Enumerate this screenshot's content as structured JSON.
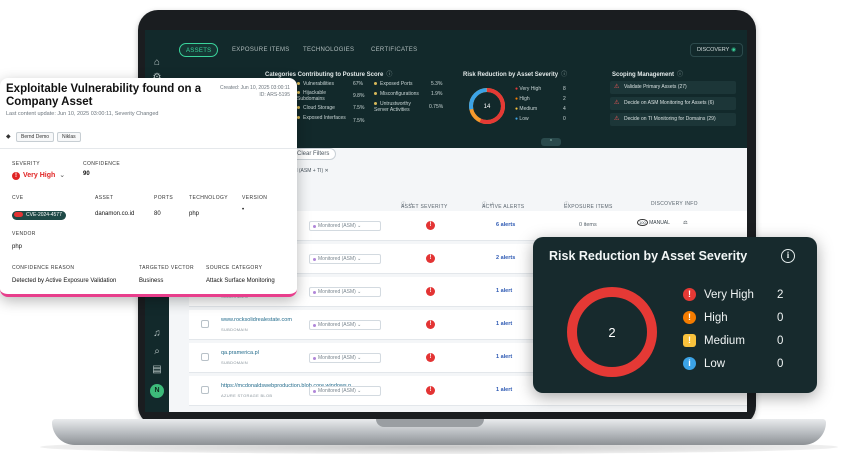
{
  "app": {
    "tabs": [
      {
        "label": "ASSETS",
        "active": true
      },
      {
        "label": "EXPOSURE ITEMS",
        "active": false
      },
      {
        "label": "TECHNOLOGIES",
        "active": false
      },
      {
        "label": "CERTIFICATES",
        "active": false
      }
    ],
    "discovery_label": "DISCOVERY",
    "categories": {
      "title": "Categories Contributing to Posture Score",
      "items": [
        {
          "label": "Vulnerabilities",
          "value": "67%"
        },
        {
          "label": "Hijackable Subdomains",
          "value": "9.8%"
        },
        {
          "label": "Cloud Storage",
          "value": "7.5%"
        },
        {
          "label": "Exposed Interfaces",
          "value": "7.5%"
        },
        {
          "label": "Exposed Ports",
          "value": "5.3%"
        },
        {
          "label": "Misconfigurations",
          "value": "1.9%"
        },
        {
          "label": "Untrustworthy Server Activities",
          "value": "0.75%"
        }
      ]
    },
    "mini_risk": {
      "title": "Risk Reduction by Asset Severity",
      "total": "14",
      "items": [
        {
          "label": "Very High",
          "value": "8"
        },
        {
          "label": "High",
          "value": "2"
        },
        {
          "label": "Medium",
          "value": "4"
        },
        {
          "label": "Low",
          "value": "0"
        }
      ]
    },
    "scoping": {
      "title": "Scoping Management",
      "items": [
        "Validate Primary Assets (27)",
        "Decide on ASM Monitoring for Assets (6)",
        "Decide on TI Monitoring for Domains (29)"
      ]
    },
    "clear_filters": "Clear Filters",
    "filter_chip": "itored (ASM + TI)",
    "table_headers": {
      "asset_severity": "ASSET SEVERITY",
      "active_alerts": "ACTIVE ALERTS",
      "exposure_items": "EXPOSURE ITEMS",
      "discovery_info": "DISCOVERY INFO"
    },
    "rows": [
      {
        "domain": "",
        "type": "",
        "monitor": "Monitored (ASM)",
        "alerts": "6 alerts",
        "exposure": "0 items",
        "discovery": "MANUAL"
      },
      {
        "domain": "",
        "type": "",
        "monitor": "Monitored (ASM)",
        "alerts": "2 alerts",
        "exposure": "",
        "discovery": ""
      },
      {
        "domain": "",
        "type": "SUBDOMAIN",
        "monitor": "Monitored (ASM)",
        "alerts": "1 alert",
        "exposure": "",
        "discovery": ""
      },
      {
        "domain": "www.rocksolidrealestate.com",
        "type": "SUBDOMAIN",
        "monitor": "Monitored (ASM)",
        "alerts": "1 alert",
        "exposure": "",
        "discovery": ""
      },
      {
        "domain": "qa.pramerica.pl",
        "type": "SUBDOMAIN",
        "monitor": "Monitored (ASM)",
        "alerts": "1 alert",
        "exposure": "",
        "discovery": ""
      },
      {
        "domain": "https://mcdonaldswebproduction.blob.core.windows.n...",
        "type": "AZURE STORAGE BLOB",
        "monitor": "Monitored (ASM)",
        "alerts": "1 alert",
        "exposure": "",
        "discovery": ""
      }
    ]
  },
  "vuln_card": {
    "title": "Exploitable Vulnerability found on a Company Asset",
    "created": "Created: Jun 10, 2025 03:00:11",
    "id": "ID: ARS-5195",
    "last_update": "Last content update: Jun 10, 2025 03:00:11, Severity Changed",
    "tags": [
      "Bernd Demo",
      "Niklas"
    ],
    "severity_label": "SEVERITY",
    "severity_value": "Very High",
    "confidence_label": "CONFIDENCE",
    "confidence_value": "90",
    "cve_label": "CVE",
    "cve_value": "CVE-2024-4577",
    "asset_label": "ASSET",
    "asset_value": "danamon.co.id",
    "ports_label": "PORTS",
    "ports_value": "80",
    "technology_label": "TECHNOLOGY",
    "technology_value": "php",
    "version_label": "VERSION",
    "version_value": "•",
    "vendor_label": "VENDOR",
    "vendor_value": "php",
    "confidence_reason_label": "CONFIDENCE REASON",
    "confidence_reason_value": "Detected by Active Exposure Validation",
    "targeted_vector_label": "TARGETED VECTOR",
    "targeted_vector_value": "Business",
    "source_category_label": "SOURCE CATEGORY",
    "source_category_value": "Attack Surface Monitoring"
  },
  "risk_card": {
    "title": "Risk Reduction by Asset Severity",
    "total": "2",
    "items": [
      {
        "label": "Very High",
        "value": "2",
        "color": "#e53935",
        "icon": "!"
      },
      {
        "label": "High",
        "value": "0",
        "color": "#f57c00",
        "icon": "!"
      },
      {
        "label": "Medium",
        "value": "0",
        "color": "#f9c23c",
        "icon": "!"
      },
      {
        "label": "Low",
        "value": "0",
        "color": "#3ba3e6",
        "icon": "i"
      }
    ],
    "donut_color": "#e53935"
  }
}
